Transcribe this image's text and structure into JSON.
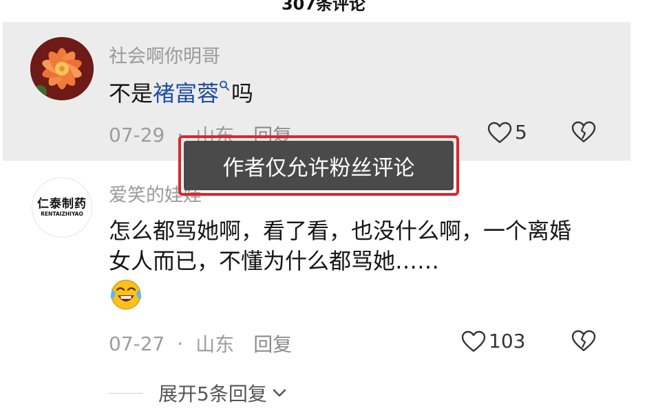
{
  "header": {
    "title": "307条评论"
  },
  "comments": [
    {
      "username": "社会啊你明哥",
      "text_before": "不是",
      "mention": "褚富蓉",
      "text_after": "吗",
      "date": "07-29",
      "location": "山东",
      "reply_label": "回复",
      "likes": "5"
    },
    {
      "username": "爱笑的娃娃",
      "avatar_logo_cn": "仁泰制药",
      "avatar_logo_en": "RENTAIZHIYAO",
      "text": "怎么都骂她啊，看了看，也没什么啊，一个离婚女人而已，不懂为什么都骂她……",
      "date": "07-27",
      "location": "山东",
      "reply_label": "回复",
      "likes": "103",
      "expand_replies": "展开5条回复"
    }
  ],
  "meta_separator": "·",
  "toast": {
    "text": "作者仅允许粉丝评论"
  },
  "icons": [
    "search-icon",
    "heart-icon",
    "broken-heart-icon",
    "chevron-down-icon",
    "laughing-crying-emoji-icon"
  ],
  "colors": {
    "mention": "#1e4ea0",
    "highlight_bg": "#ececec",
    "toast_bg": "#4a4a4a",
    "annotation_border": "#e0242a"
  }
}
